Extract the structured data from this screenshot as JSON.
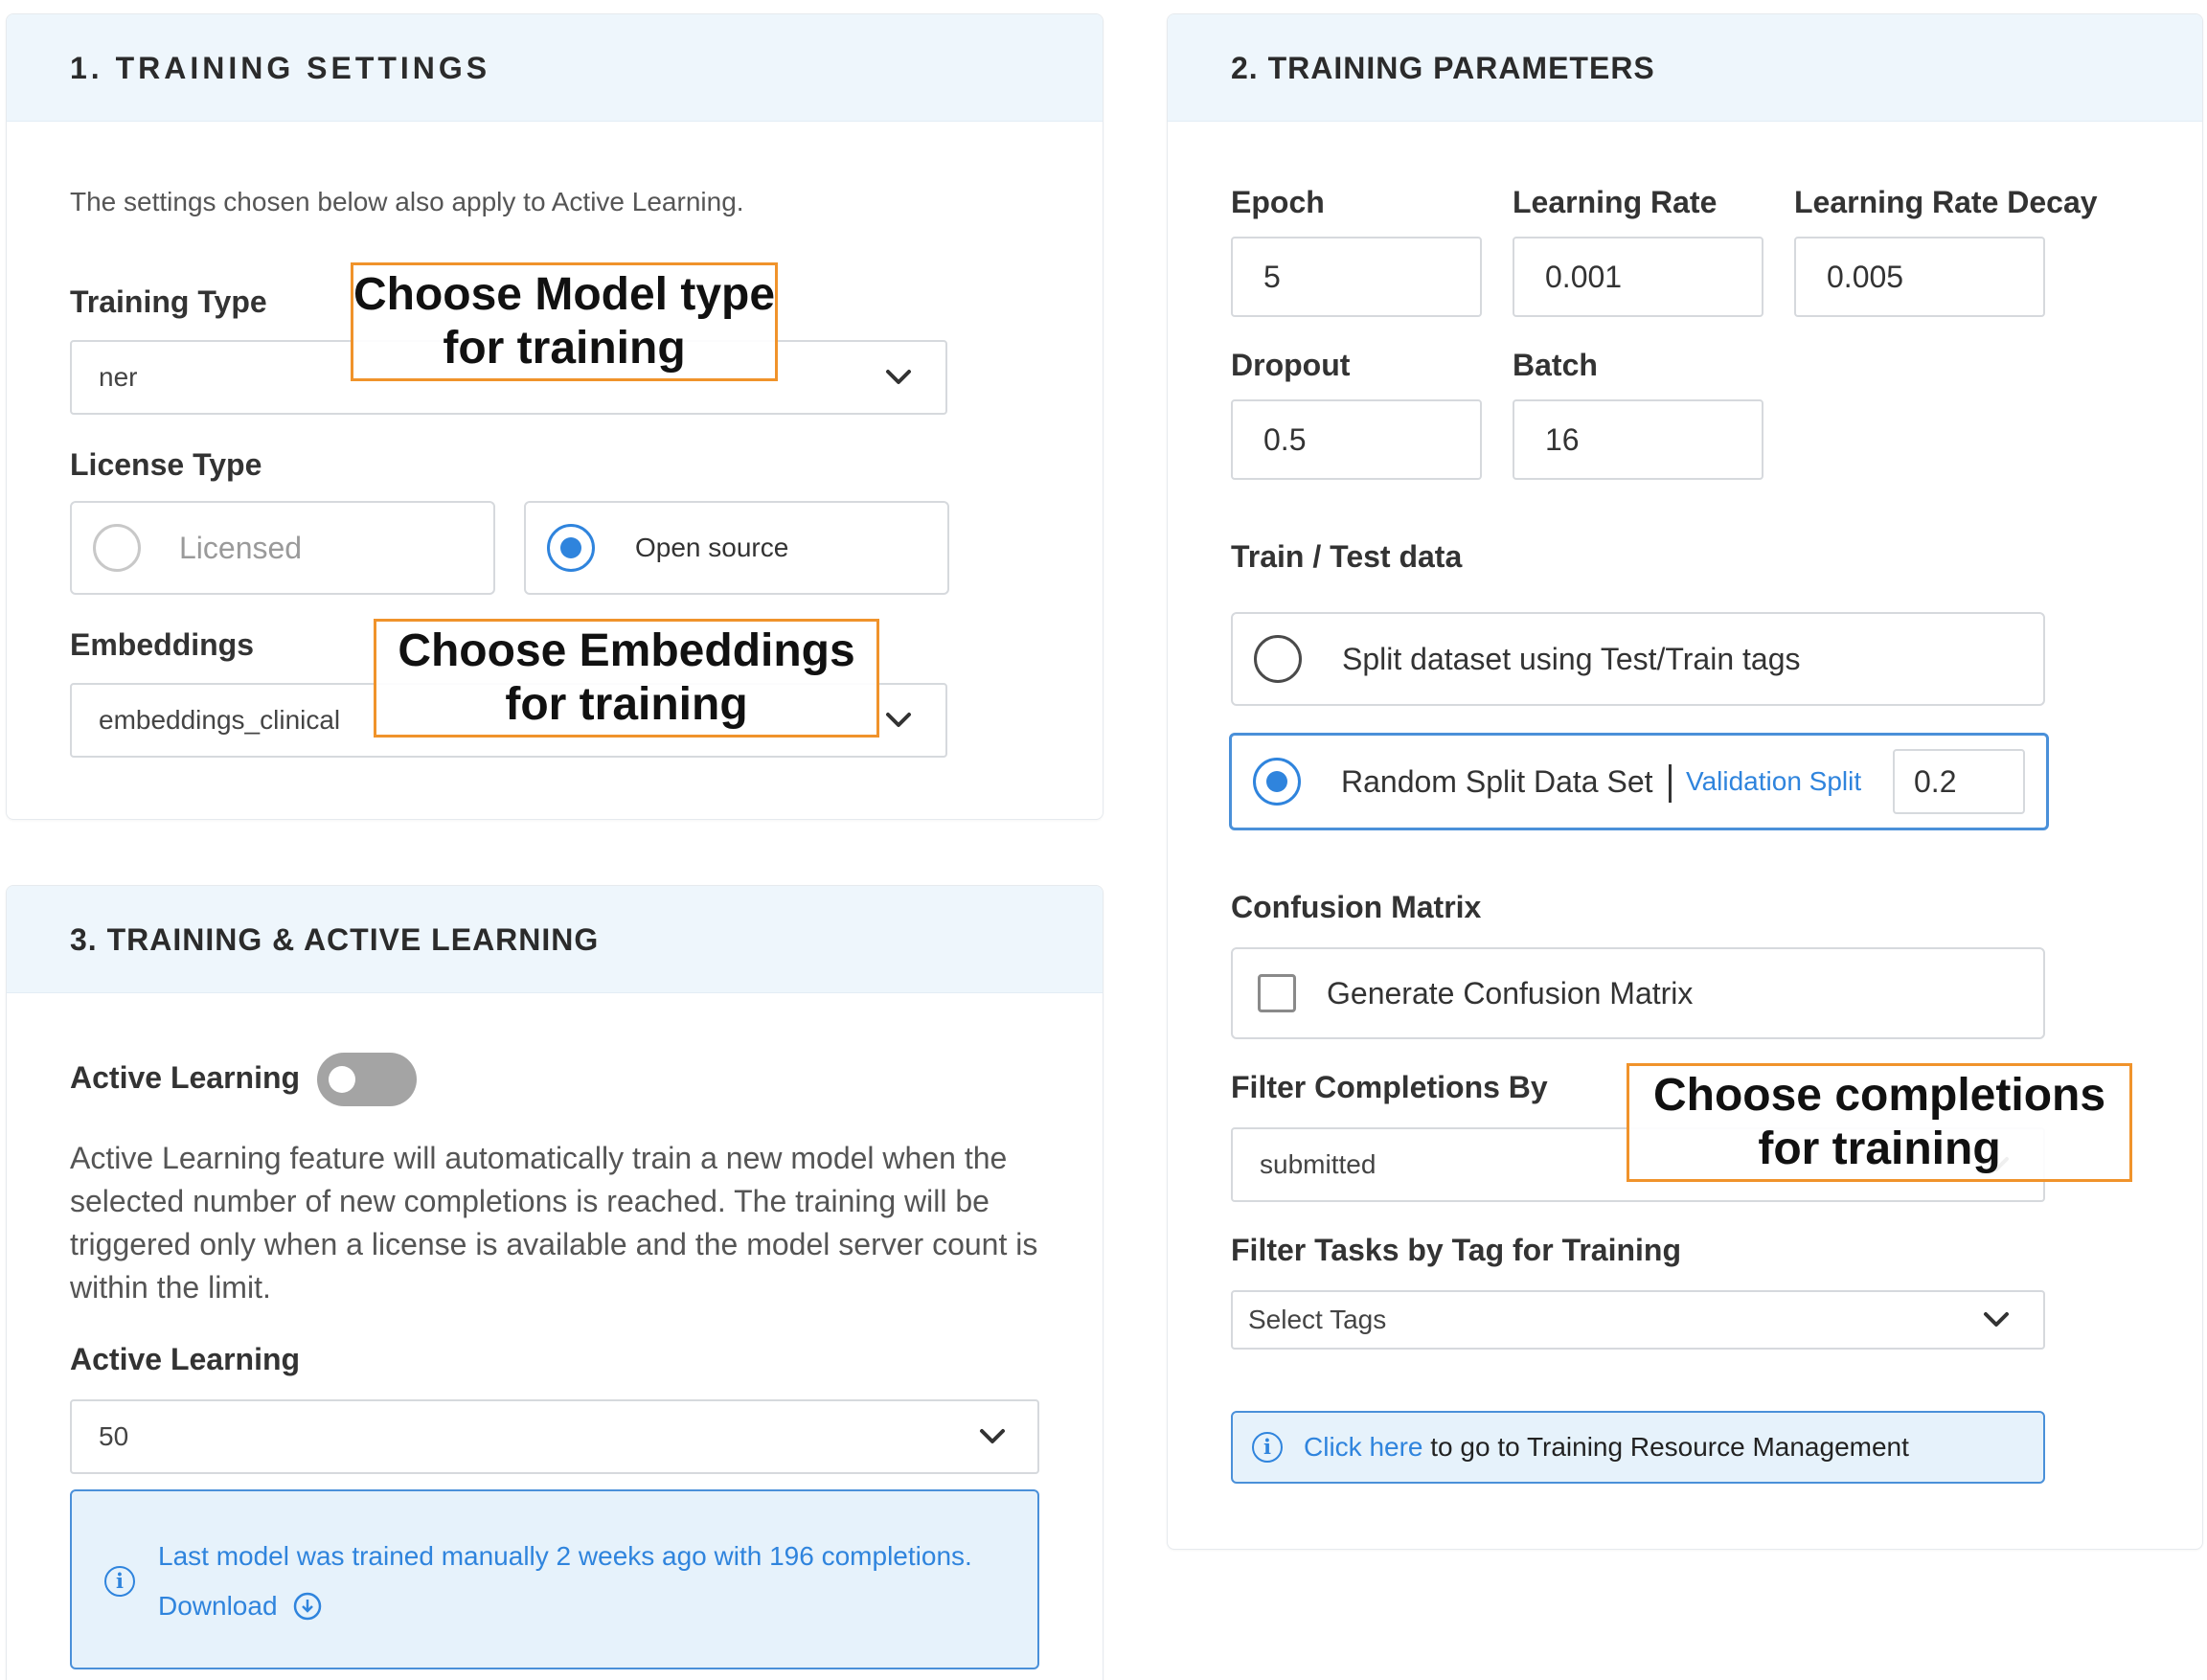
{
  "training_settings": {
    "title": "1. TRAINING SETTINGS",
    "note": "The settings chosen below also apply to Active Learning.",
    "training_type": {
      "label": "Training Type",
      "value": "ner"
    },
    "license_type": {
      "label": "License Type",
      "options": [
        {
          "label": "Licensed",
          "selected": false
        },
        {
          "label": "Open source",
          "selected": true
        }
      ]
    },
    "embeddings": {
      "label": "Embeddings",
      "value": "embeddings_clinical"
    }
  },
  "training_active_learning": {
    "title": "3. TRAINING & ACTIVE LEARNING",
    "toggle_label": "Active Learning",
    "toggle_on": false,
    "description": "Active Learning feature will automatically train a new model when the selected number of new completions is reached. The training will be triggered only when a license is available and the model server count is within the limit.",
    "count_label": "Active Learning",
    "count_value": "50",
    "info_text": "Last model was trained manually 2 weeks ago with 196 completions.",
    "download_label": "Download"
  },
  "training_parameters": {
    "title": "2. TRAINING PARAMETERS",
    "epoch": {
      "label": "Epoch",
      "value": "5"
    },
    "learning_rate": {
      "label": "Learning Rate",
      "value": "0.001"
    },
    "learning_rate_decay": {
      "label": "Learning Rate Decay",
      "value": "0.005"
    },
    "dropout": {
      "label": "Dropout",
      "value": "0.5"
    },
    "batch": {
      "label": "Batch",
      "value": "16"
    },
    "train_test": {
      "label": "Train / Test data",
      "split_tags_label": "Split dataset using Test/Train tags",
      "random_split_label": "Random Split Data Set",
      "validation_split_label": "Validation Split",
      "validation_split_value": "0.2",
      "selected": "random"
    },
    "confusion_matrix": {
      "label": "Confusion Matrix",
      "checkbox_label": "Generate Confusion Matrix",
      "checked": false
    },
    "filter_completions": {
      "label": "Filter Completions By",
      "value": "submitted"
    },
    "filter_tags": {
      "label": "Filter Tasks by Tag for Training",
      "placeholder": "Select Tags"
    },
    "resource_link": {
      "link_text": "Click here",
      "rest_text": " to go to Training Resource Management"
    }
  },
  "callouts": {
    "model_type": [
      "Choose Model type",
      "for training"
    ],
    "embeddings": [
      "Choose Embeddings",
      "for training"
    ],
    "completions": [
      "Choose completions",
      "for training"
    ]
  },
  "colors": {
    "accent": "#2f84dd",
    "header_bg": "#eef6fc",
    "callout_border": "#f0932b",
    "info_bg": "#e6f2fb"
  }
}
